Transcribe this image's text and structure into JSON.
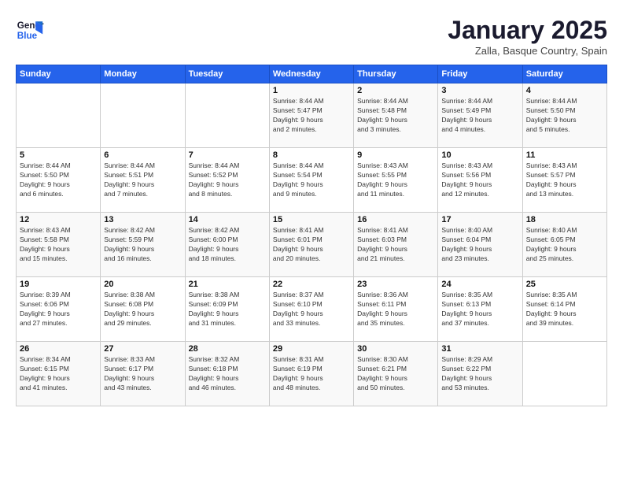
{
  "logo": {
    "general": "General",
    "blue": "Blue"
  },
  "header": {
    "title": "January 2025",
    "location": "Zalla, Basque Country, Spain"
  },
  "weekdays": [
    "Sunday",
    "Monday",
    "Tuesday",
    "Wednesday",
    "Thursday",
    "Friday",
    "Saturday"
  ],
  "weeks": [
    [
      {
        "day": "",
        "info": ""
      },
      {
        "day": "",
        "info": ""
      },
      {
        "day": "",
        "info": ""
      },
      {
        "day": "1",
        "info": "Sunrise: 8:44 AM\nSunset: 5:47 PM\nDaylight: 9 hours\nand 2 minutes."
      },
      {
        "day": "2",
        "info": "Sunrise: 8:44 AM\nSunset: 5:48 PM\nDaylight: 9 hours\nand 3 minutes."
      },
      {
        "day": "3",
        "info": "Sunrise: 8:44 AM\nSunset: 5:49 PM\nDaylight: 9 hours\nand 4 minutes."
      },
      {
        "day": "4",
        "info": "Sunrise: 8:44 AM\nSunset: 5:50 PM\nDaylight: 9 hours\nand 5 minutes."
      }
    ],
    [
      {
        "day": "5",
        "info": "Sunrise: 8:44 AM\nSunset: 5:50 PM\nDaylight: 9 hours\nand 6 minutes."
      },
      {
        "day": "6",
        "info": "Sunrise: 8:44 AM\nSunset: 5:51 PM\nDaylight: 9 hours\nand 7 minutes."
      },
      {
        "day": "7",
        "info": "Sunrise: 8:44 AM\nSunset: 5:52 PM\nDaylight: 9 hours\nand 8 minutes."
      },
      {
        "day": "8",
        "info": "Sunrise: 8:44 AM\nSunset: 5:54 PM\nDaylight: 9 hours\nand 9 minutes."
      },
      {
        "day": "9",
        "info": "Sunrise: 8:43 AM\nSunset: 5:55 PM\nDaylight: 9 hours\nand 11 minutes."
      },
      {
        "day": "10",
        "info": "Sunrise: 8:43 AM\nSunset: 5:56 PM\nDaylight: 9 hours\nand 12 minutes."
      },
      {
        "day": "11",
        "info": "Sunrise: 8:43 AM\nSunset: 5:57 PM\nDaylight: 9 hours\nand 13 minutes."
      }
    ],
    [
      {
        "day": "12",
        "info": "Sunrise: 8:43 AM\nSunset: 5:58 PM\nDaylight: 9 hours\nand 15 minutes."
      },
      {
        "day": "13",
        "info": "Sunrise: 8:42 AM\nSunset: 5:59 PM\nDaylight: 9 hours\nand 16 minutes."
      },
      {
        "day": "14",
        "info": "Sunrise: 8:42 AM\nSunset: 6:00 PM\nDaylight: 9 hours\nand 18 minutes."
      },
      {
        "day": "15",
        "info": "Sunrise: 8:41 AM\nSunset: 6:01 PM\nDaylight: 9 hours\nand 20 minutes."
      },
      {
        "day": "16",
        "info": "Sunrise: 8:41 AM\nSunset: 6:03 PM\nDaylight: 9 hours\nand 21 minutes."
      },
      {
        "day": "17",
        "info": "Sunrise: 8:40 AM\nSunset: 6:04 PM\nDaylight: 9 hours\nand 23 minutes."
      },
      {
        "day": "18",
        "info": "Sunrise: 8:40 AM\nSunset: 6:05 PM\nDaylight: 9 hours\nand 25 minutes."
      }
    ],
    [
      {
        "day": "19",
        "info": "Sunrise: 8:39 AM\nSunset: 6:06 PM\nDaylight: 9 hours\nand 27 minutes."
      },
      {
        "day": "20",
        "info": "Sunrise: 8:38 AM\nSunset: 6:08 PM\nDaylight: 9 hours\nand 29 minutes."
      },
      {
        "day": "21",
        "info": "Sunrise: 8:38 AM\nSunset: 6:09 PM\nDaylight: 9 hours\nand 31 minutes."
      },
      {
        "day": "22",
        "info": "Sunrise: 8:37 AM\nSunset: 6:10 PM\nDaylight: 9 hours\nand 33 minutes."
      },
      {
        "day": "23",
        "info": "Sunrise: 8:36 AM\nSunset: 6:11 PM\nDaylight: 9 hours\nand 35 minutes."
      },
      {
        "day": "24",
        "info": "Sunrise: 8:35 AM\nSunset: 6:13 PM\nDaylight: 9 hours\nand 37 minutes."
      },
      {
        "day": "25",
        "info": "Sunrise: 8:35 AM\nSunset: 6:14 PM\nDaylight: 9 hours\nand 39 minutes."
      }
    ],
    [
      {
        "day": "26",
        "info": "Sunrise: 8:34 AM\nSunset: 6:15 PM\nDaylight: 9 hours\nand 41 minutes."
      },
      {
        "day": "27",
        "info": "Sunrise: 8:33 AM\nSunset: 6:17 PM\nDaylight: 9 hours\nand 43 minutes."
      },
      {
        "day": "28",
        "info": "Sunrise: 8:32 AM\nSunset: 6:18 PM\nDaylight: 9 hours\nand 46 minutes."
      },
      {
        "day": "29",
        "info": "Sunrise: 8:31 AM\nSunset: 6:19 PM\nDaylight: 9 hours\nand 48 minutes."
      },
      {
        "day": "30",
        "info": "Sunrise: 8:30 AM\nSunset: 6:21 PM\nDaylight: 9 hours\nand 50 minutes."
      },
      {
        "day": "31",
        "info": "Sunrise: 8:29 AM\nSunset: 6:22 PM\nDaylight: 9 hours\nand 53 minutes."
      },
      {
        "day": "",
        "info": ""
      }
    ]
  ]
}
